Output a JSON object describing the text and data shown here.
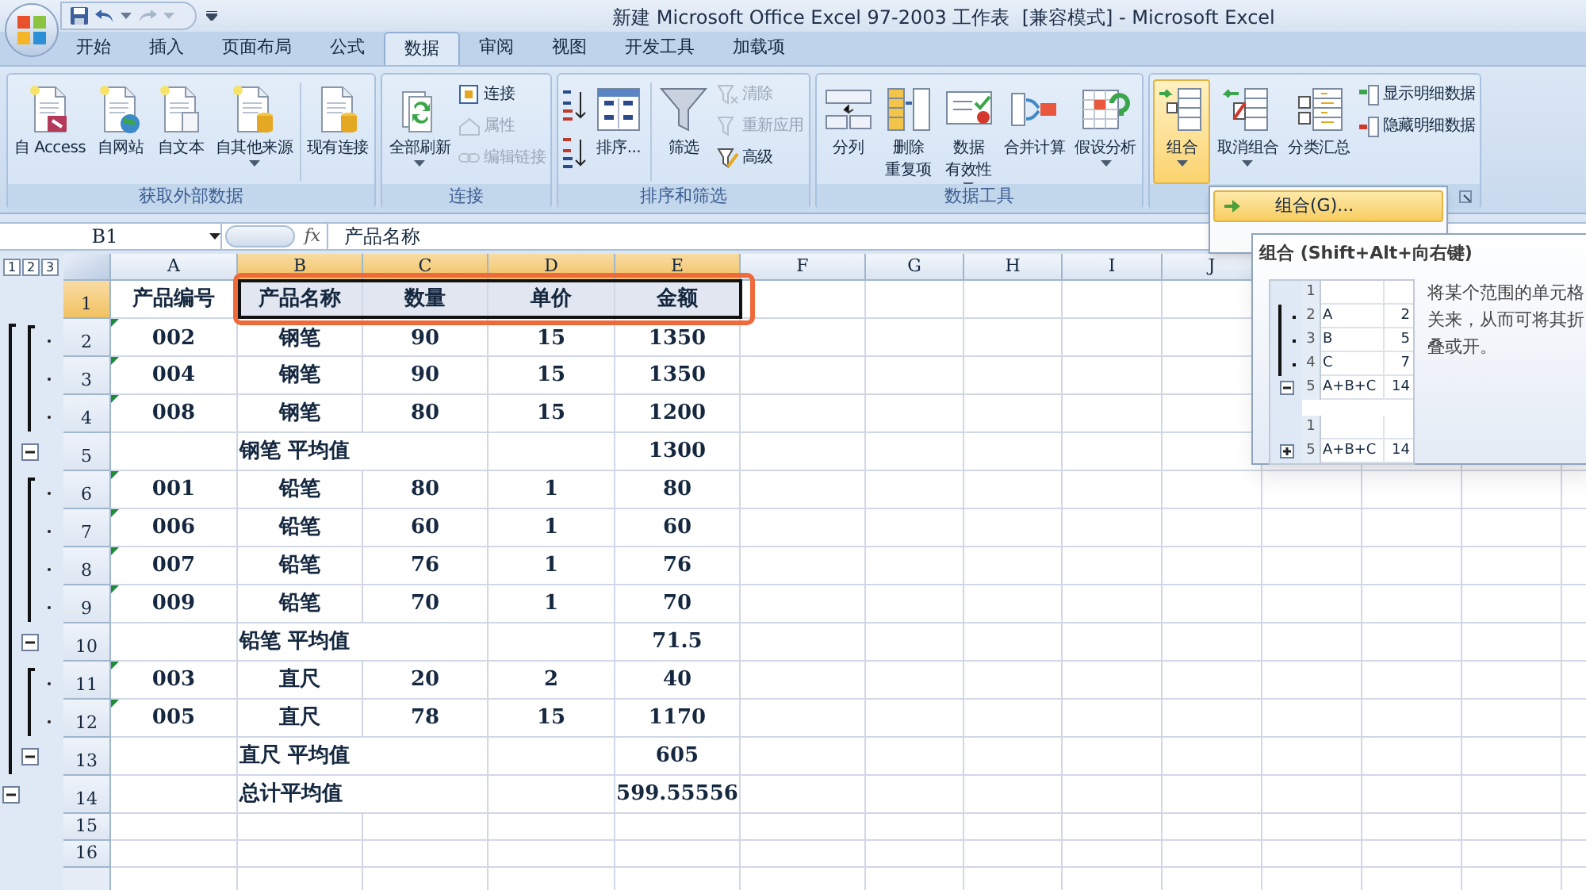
{
  "window": {
    "title": "新建 Microsoft Office Excel 97-2003 工作表  [兼容模式] - Microsoft Excel"
  },
  "ribbon": {
    "tabs": [
      {
        "label": "开始",
        "selected": false
      },
      {
        "label": "插入",
        "selected": false
      },
      {
        "label": "页面布局",
        "selected": false
      },
      {
        "label": "公式",
        "selected": false
      },
      {
        "label": "数据",
        "selected": true
      },
      {
        "label": "审阅",
        "selected": false
      },
      {
        "label": "视图",
        "selected": false
      },
      {
        "label": "开发工具",
        "selected": false
      },
      {
        "label": "加载项",
        "selected": false
      }
    ],
    "groups": [
      {
        "label": "获取外部数据",
        "buttons": [
          {
            "kind": "large",
            "label": "自 Access"
          },
          {
            "kind": "large",
            "label": "自网站"
          },
          {
            "kind": "large",
            "label": "自文本"
          },
          {
            "kind": "large",
            "label": "自其他来源",
            "dropdown": true
          },
          {
            "kind": "separator"
          },
          {
            "kind": "large",
            "label": "现有连接"
          }
        ]
      },
      {
        "label": "连接",
        "buttons": [
          {
            "kind": "large",
            "label": "全部刷新",
            "dropdown": true
          },
          {
            "kind": "small",
            "label": "连接",
            "disabled": false
          },
          {
            "kind": "small",
            "label": "属性",
            "disabled": true
          },
          {
            "kind": "small",
            "label": "编辑链接",
            "disabled": true
          }
        ]
      },
      {
        "label": "排序和筛选",
        "buttons": [
          {
            "kind": "icon"
          },
          {
            "kind": "icon"
          },
          {
            "kind": "large",
            "label": "排序..."
          },
          {
            "kind": "separator"
          },
          {
            "kind": "large",
            "label": "筛选"
          },
          {
            "kind": "small",
            "label": "清除",
            "disabled": true
          },
          {
            "kind": "small",
            "label": "重新应用",
            "disabled": true
          },
          {
            "kind": "small",
            "label": "高级",
            "disabled": false
          }
        ]
      },
      {
        "label": "数据工具",
        "buttons": [
          {
            "kind": "large",
            "label": "分列"
          },
          {
            "kind": "large",
            "label": [
              "删除",
              "重复项"
            ]
          },
          {
            "kind": "large",
            "label": [
              "数据",
              "有效性"
            ],
            "dropdown": true
          },
          {
            "kind": "large",
            "label": "合并计算"
          },
          {
            "kind": "large",
            "label": "假设分析",
            "dropdown": true
          }
        ]
      },
      {
        "buttons": [
          {
            "kind": "large",
            "label": "组合",
            "dropdown": true,
            "pressed": true
          },
          {
            "kind": "large",
            "label": "取消组合",
            "dropdown": true,
            "pressed": false
          },
          {
            "kind": "large",
            "label": "分类汇总",
            "pressed": false
          },
          {
            "kind": "small",
            "label": "显示明细数据",
            "disabled": false
          },
          {
            "kind": "small",
            "label": "隐藏明细数据",
            "disabled": false
          }
        ]
      }
    ]
  },
  "formula_bar": {
    "name_box": "B1",
    "function_button": "fx",
    "formula": "产品名称"
  },
  "outline_levels": [
    "1",
    "2",
    "3"
  ],
  "columns": [
    {
      "label": "A",
      "selected": false
    },
    {
      "label": "B",
      "selected": true
    },
    {
      "label": "C",
      "selected": true
    },
    {
      "label": "D",
      "selected": true
    },
    {
      "label": "E",
      "selected": true
    },
    {
      "label": "F",
      "selected": false
    },
    {
      "label": "G",
      "selected": false
    },
    {
      "label": "H",
      "selected": false
    },
    {
      "label": "I",
      "selected": false
    },
    {
      "label": "J",
      "selected": false
    }
  ],
  "rows": [
    {
      "number": "1",
      "kind": "header",
      "selected": true,
      "cells": [
        "产品编号",
        "产品名称",
        "数量",
        "单价",
        "金额"
      ]
    },
    {
      "number": "2",
      "kind": "detail",
      "selected": false,
      "cells": [
        "002",
        "钢笔",
        "90",
        "15",
        "1350"
      ]
    },
    {
      "number": "3",
      "kind": "detail",
      "selected": false,
      "cells": [
        "004",
        "钢笔",
        "90",
        "15",
        "1350"
      ]
    },
    {
      "number": "4",
      "kind": "detail",
      "selected": false,
      "cells": [
        "008",
        "钢笔",
        "80",
        "15",
        "1200"
      ]
    },
    {
      "number": "5",
      "kind": "subtotal",
      "selected": false,
      "expanded": true,
      "label": "钢笔 平均值",
      "value": "1300"
    },
    {
      "number": "6",
      "kind": "detail",
      "selected": false,
      "cells": [
        "001",
        "铅笔",
        "80",
        "1",
        "80"
      ]
    },
    {
      "number": "7",
      "kind": "detail",
      "selected": false,
      "cells": [
        "006",
        "铅笔",
        "60",
        "1",
        "60"
      ]
    },
    {
      "number": "8",
      "kind": "detail",
      "selected": false,
      "cells": [
        "007",
        "铅笔",
        "76",
        "1",
        "76"
      ]
    },
    {
      "number": "9",
      "kind": "detail",
      "selected": false,
      "cells": [
        "009",
        "铅笔",
        "70",
        "1",
        "70"
      ]
    },
    {
      "number": "10",
      "kind": "subtotal",
      "selected": false,
      "expanded": true,
      "label": "铅笔 平均值",
      "value": "71.5"
    },
    {
      "number": "11",
      "kind": "detail",
      "selected": false,
      "cells": [
        "003",
        "直尺",
        "20",
        "2",
        "40"
      ]
    },
    {
      "number": "12",
      "kind": "detail",
      "selected": false,
      "cells": [
        "005",
        "直尺",
        "78",
        "15",
        "1170"
      ]
    },
    {
      "number": "13",
      "kind": "subtotal",
      "selected": false,
      "expanded": true,
      "label": "直尺 平均值",
      "value": "605"
    },
    {
      "number": "14",
      "kind": "total",
      "selected": false,
      "expanded": true,
      "label": "总计平均值",
      "value": "599.55556"
    },
    {
      "number": "15",
      "kind": "empty",
      "selected": false
    },
    {
      "number": "16",
      "kind": "empty",
      "selected": false
    }
  ],
  "menu": {
    "items": [
      {
        "label": "组合(G)...",
        "selected": true
      }
    ]
  },
  "tooltip": {
    "title": "组合 (Shift+Alt+向右键)",
    "description": "将某个范围的单元格关来，从而可将其折叠或开。",
    "examples": [
      {
        "expanded": true,
        "rows": [
          [
            "1"
          ],
          [
            "2",
            "A",
            "2"
          ],
          [
            "3",
            "B",
            "5"
          ],
          [
            "4",
            "C",
            "7"
          ],
          [
            "5",
            "A+B+C",
            "14"
          ]
        ]
      },
      {
        "expanded": false,
        "rows": [
          [
            "1"
          ],
          [
            "5",
            "A+B+C",
            "14"
          ]
        ]
      }
    ]
  }
}
